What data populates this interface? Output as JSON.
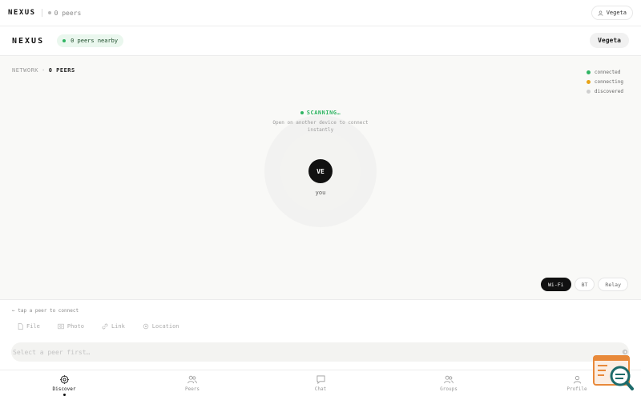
{
  "topbar": {
    "brand": "NEXUS",
    "peers": "0 peers",
    "user": "Vegeta"
  },
  "header": {
    "brand": "NEXUS",
    "nearby": "0 peers nearby",
    "user": "Vegeta"
  },
  "network": {
    "label": "NETWORK",
    "sep": "·",
    "count": "0 PEERS",
    "legend": [
      {
        "label": "connected",
        "color": "#2fb463"
      },
      {
        "label": "connecting",
        "color": "#e8a317"
      },
      {
        "label": "discovered",
        "color": "#cfcfcf"
      }
    ],
    "status": "SCANNING…",
    "hint_line1": "Open on another device to connect",
    "hint_line2": "instantly",
    "me_initials": "VE",
    "me_label": "you",
    "transports": [
      "Wi-Fi",
      "BT",
      "Relay"
    ],
    "active_transport": "Wi-Fi"
  },
  "composer": {
    "tap_hint": "← tap a peer to connect",
    "attachments": [
      "File",
      "Photo",
      "Link",
      "Location"
    ],
    "placeholder": "Select a peer first…"
  },
  "nav": {
    "items": [
      {
        "label": "Discover",
        "icon": "compass-icon",
        "active": true
      },
      {
        "label": "Peers",
        "icon": "users-icon",
        "active": false
      },
      {
        "label": "Chat",
        "icon": "chat-icon",
        "active": false
      },
      {
        "label": "Groups",
        "icon": "group-icon",
        "active": false
      },
      {
        "label": "Profile",
        "icon": "user-icon",
        "active": false
      }
    ]
  }
}
